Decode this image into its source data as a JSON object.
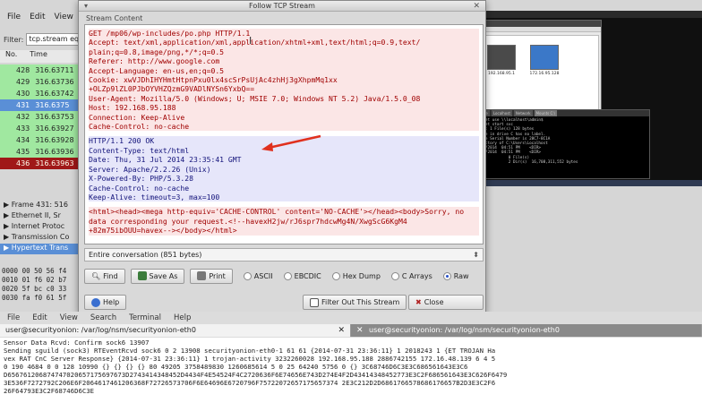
{
  "wireshark": {
    "menu": [
      "File",
      "Edit",
      "View"
    ],
    "filter_label": "Filter:",
    "filter_value": "tcp.stream eq",
    "columns": [
      "No.",
      "Time"
    ],
    "rows": [
      {
        "no": "428",
        "time": "316.63711"
      },
      {
        "no": "429",
        "time": "316.63736"
      },
      {
        "no": "430",
        "time": "316.63742"
      },
      {
        "no": "431",
        "time": "316.6375"
      },
      {
        "no": "432",
        "time": "316.63753"
      },
      {
        "no": "433",
        "time": "316.63927"
      },
      {
        "no": "434",
        "time": "316.63928"
      },
      {
        "no": "435",
        "time": "316.63936"
      },
      {
        "no": "436",
        "time": "316.63963"
      }
    ],
    "details": [
      "▶ Frame 431: 516",
      "▶ Ethernet II, Sr",
      "▶ Internet Protoc",
      "▶ Transmission Co",
      "▶ Hypertext Trans"
    ],
    "hex": [
      "0000  00 50 56 f4",
      "0010  01 f6 02 b7",
      "0020  5f bc c0 33",
      "0030  fa f0 61 5f"
    ]
  },
  "dialog": {
    "title": "Follow TCP Stream",
    "section": "Stream Content",
    "request_lines": [
      "GET /mp06/wp-includes/po.php HTTP/1.1",
      "Accept: text/xml,application/xml,application/xhtml+xml,text/html;q=0.9,text/",
      "plain;q=0.8,image/png,*/*;q=0.5",
      "Referer: http://www.google.com",
      "Accept-Language: en-us,en;q=0.5",
      "Cookie: xwVJDhIHYHmtHtpnPxu0lx4scSrPsUjAc4zhHj3gXhpmMq1xx",
      "+OLZp9lZL0PJbOYVHZQzmG9VADlNYSn6YxbQ==",
      "User-Agent: Mozilla/5.0 (Windows; U; MSIE 7.0; Windows NT 5.2) Java/1.5.0_08",
      "Host: 192.168.95.188",
      "Connection: Keep-Alive",
      "Cache-Control: no-cache"
    ],
    "response_lines": [
      "HTTP/1.1 200 OK",
      "Content-Type: text/html",
      "Date: Thu, 31 Jul 2014 23:35:41 GMT",
      "Server: Apache/2.2.26 (Unix)",
      "X-Powered-By: PHP/5.3.28",
      "Cache-Control: no-cache",
      "Keep-Alive: timeout=3, max=100"
    ],
    "response_body": [
      "<html><head><mega http-equiv='CACHE-CONTROL' content='NO-CACHE'></head><body>Sorry, no",
      "data corresponding your request.<!--havexH2jw/rJ6spr7hdcwMg4N/XwgScG6KgM4",
      "+82m75ibOUU=havex--></body></html>"
    ],
    "conversation": "Entire conversation (851 bytes)",
    "buttons": {
      "find": "Find",
      "save_as": "Save As",
      "print": "Print",
      "help": "Help",
      "filter_out": "Filter Out This Stream",
      "close": "Close"
    },
    "formats": [
      "ASCII",
      "EBCDIC",
      "Hex Dump",
      "C Arrays",
      "Raw"
    ],
    "selected_format": "Raw"
  },
  "thumbnail": {
    "window_title": "Follow TCP Stream",
    "terminal_tabs": [
      "Console",
      "Localhost",
      "Network",
      "Mounts C:\\"
    ],
    "terminal_lines": [
      "C:\\>net use \\\\localhost\\admin$",
      "C:\\>net start svc",
      "Drive: 1 File(s) 128 bytes",
      "Volume in drive C has no label.",
      "Volume Serial Number is 28C7-8C1A",
      "",
      " Directory of C:\\Users\\Localhost",
      "",
      "07/31/2014  04:51 PM    <DIR>",
      "07/31/2014  04:51 PM    <DIR>",
      "               0 File(s)",
      "               2 Dir(s)  16,708,311,552 bytes"
    ],
    "tiles": [
      "192.168.95.1",
      "172.16.95.128"
    ]
  },
  "terminal": {
    "menu": [
      "File",
      "Edit",
      "View",
      "Search",
      "Terminal",
      "Help"
    ],
    "tab1": "user@securityonion: /var/log/nsm/securityonion-eth0",
    "tab2": "user@securityonion: /var/log/nsm/securityonion-eth0",
    "lines": [
      "Sensor Data Rcvd: Confirm sock6 13907",
      "Sending sguild (sock3) RTEventRcvd sock6 0 2 13908 securityonion-eth0-1 61 61 {2014-07-31 23:36:11} 1 2018243 1 {ET TROJAN Ha",
      "vex RAT CnC Server Response} {2014-07-31 23:36:11} 1 trojan-activity 3232260028 192.168.95.188 2886742155 172.16.48.139 6 4 5",
      "0 190 4684 0 0 128 10990 {} {} {} {} 80 49205 3758489830 1260685614 5 0 25 64240 5756 0 {} 3C68746D6C3E3C686561643E3C6",
      "D656761206874747020657175697673D2743414348452D4434F4E54524F4C2720636F6E74656E743D274E4F2D43414348452773E3C2F686561643E3C626F6479",
      "3E536F7272792C206E6F2064617461206368F72726573706F6E64696E6720796F75722072657175657374 2E3C212D2D6861766578686176657B2D3E3C2F6",
      "26F64793E3C2F68746D6C3E"
    ]
  },
  "colors": {
    "request_text": "#a00000",
    "request_bg": "#fbe6e6",
    "response_text": "#12127a",
    "response_bg": "#e6e6fa",
    "annotation_arrow": "#e0301e",
    "selected_row": "#5a8fd6",
    "alert_row": "#a01818"
  }
}
